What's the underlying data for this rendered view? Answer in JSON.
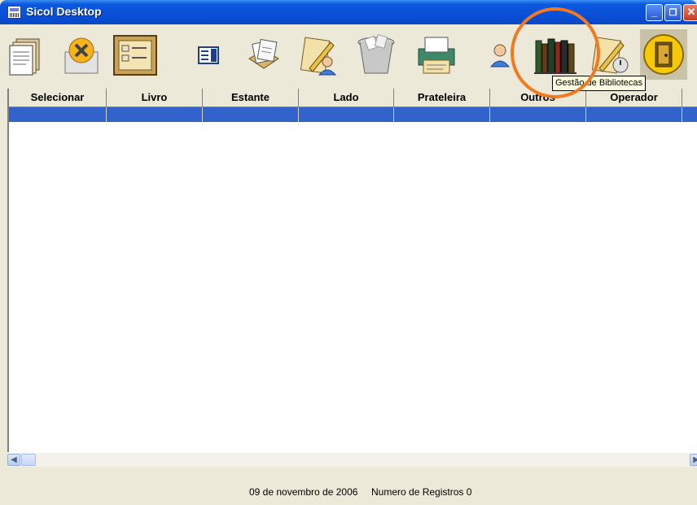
{
  "window": {
    "title": "Sicol Desktop",
    "controls": [
      "minimize",
      "restore",
      "close"
    ]
  },
  "toolbar": {
    "buttons": [
      {
        "icon": "document-stack-icon"
      },
      {
        "icon": "delete-x-icon"
      },
      {
        "icon": "form-list-icon"
      },
      {
        "icon": "list-select-icon"
      },
      {
        "icon": "papers-icon"
      },
      {
        "icon": "edit-user-icon"
      },
      {
        "icon": "trash-icon"
      },
      {
        "icon": "printer-icon"
      },
      {
        "icon": "user-icon"
      },
      {
        "icon": "library-books-icon",
        "tooltip": "Gestão de Bibliotecas"
      },
      {
        "icon": "edit-timer-icon"
      },
      {
        "icon": "exit-door-icon"
      }
    ]
  },
  "grid": {
    "columns": [
      "Selecionar",
      "Livro",
      "Estante",
      "Lado",
      "Prateleira",
      "Outros",
      "Operador"
    ],
    "rows": []
  },
  "tooltip": {
    "text": "Gestão de Bibliotecas"
  },
  "status": {
    "date": "09 de novembro de 2006",
    "records": "Numero de Registros 0"
  },
  "colors": {
    "title_bar": "#0A58DE",
    "selection": "#3163CB",
    "highlight_circle": "#F07A22",
    "tooltip_bg": "#FFFFE1"
  }
}
